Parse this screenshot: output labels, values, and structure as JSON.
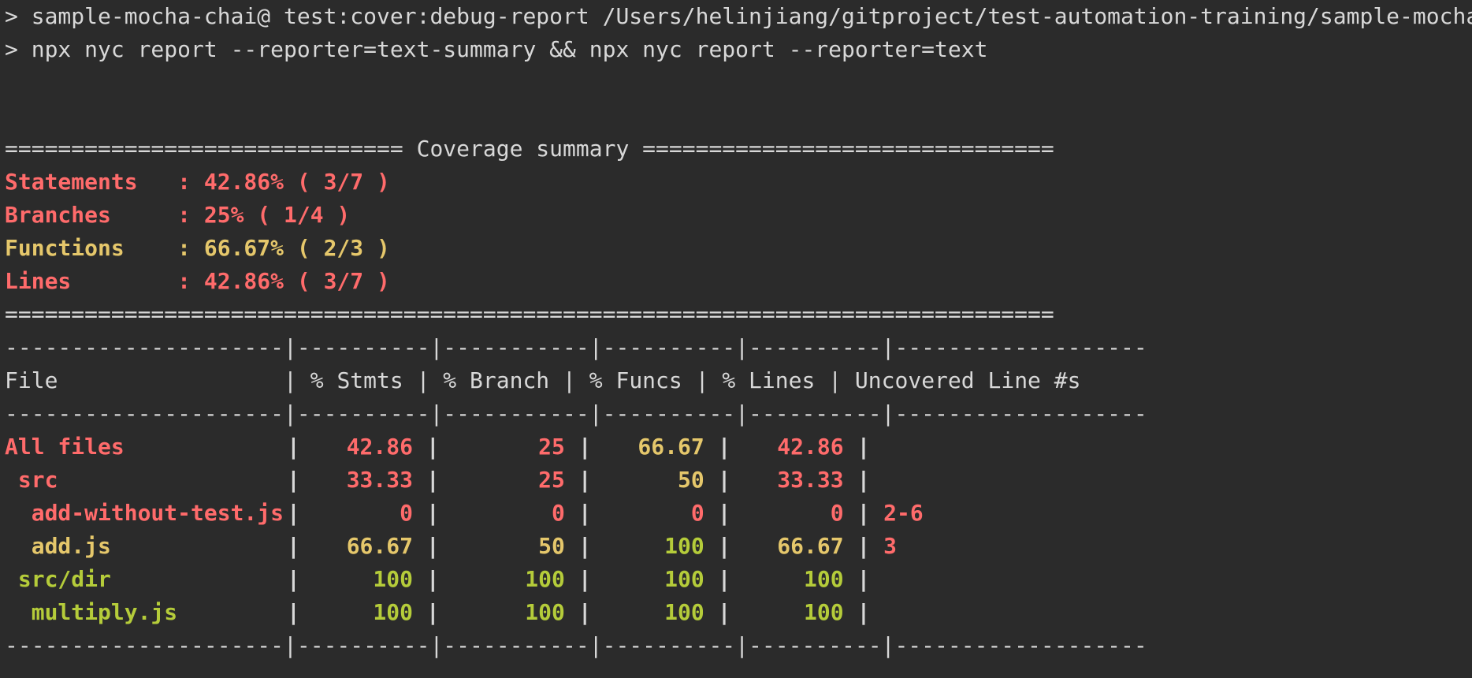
{
  "command": {
    "line1": "> sample-mocha-chai@ test:cover:debug-report /Users/helinjiang/gitproject/test-automation-training/sample-mocha-chai",
    "line2": "> npx nyc report --reporter=text-summary && npx nyc report --reporter=text"
  },
  "summary": {
    "header": "============================== Coverage summary ===============================",
    "footer": "===============================================================================",
    "rows": [
      {
        "text": "Statements   : 42.86% ( 3/7 )",
        "color": "#ff6b6b"
      },
      {
        "text": "Branches     : 25% ( 1/4 )",
        "color": "#ff6b6b"
      },
      {
        "text": "Functions    : 66.67% ( 2/3 )",
        "color": "#e5c76b"
      },
      {
        "text": "Lines        : 42.86% ( 3/7 )",
        "color": "#ff6b6b"
      }
    ]
  },
  "table": {
    "divider": "---------------------|----------|-----------|----------|----------|-------------------",
    "headers": {
      "file": "File                 ",
      "stmts": "| % Stmts ",
      "branch": "| % Branch ",
      "funcs": "| % Funcs ",
      "lines": "| % Lines ",
      "uncovered": "| Uncovered Line #s"
    },
    "rows": [
      {
        "file": "All files",
        "stmts": "42.86",
        "branch": "25",
        "funcs": "66.67",
        "lines": "42.86",
        "uncovered": ""
      },
      {
        "file": " src",
        "stmts": "33.33",
        "branch": "25",
        "funcs": "50",
        "lines": "33.33",
        "uncovered": ""
      },
      {
        "file": "  add-without-test.js",
        "stmts": "0",
        "branch": "0",
        "funcs": "0",
        "lines": "0",
        "uncovered": "2-6"
      },
      {
        "file": "  add.js",
        "stmts": "66.67",
        "branch": "50",
        "funcs": "100",
        "lines": "66.67",
        "uncovered": "3"
      },
      {
        "file": " src/dir",
        "stmts": "100",
        "branch": "100",
        "funcs": "100",
        "lines": "100",
        "uncovered": ""
      },
      {
        "file": "  multiply.js",
        "stmts": "100",
        "branch": "100",
        "funcs": "100",
        "lines": "100",
        "uncovered": ""
      }
    ]
  },
  "colors": {
    "background": "#2b2b2b",
    "text": "#d8d8d8",
    "red": "#ff6b6b",
    "yellow": "#e5c76b",
    "green": "#b5cc3a"
  }
}
